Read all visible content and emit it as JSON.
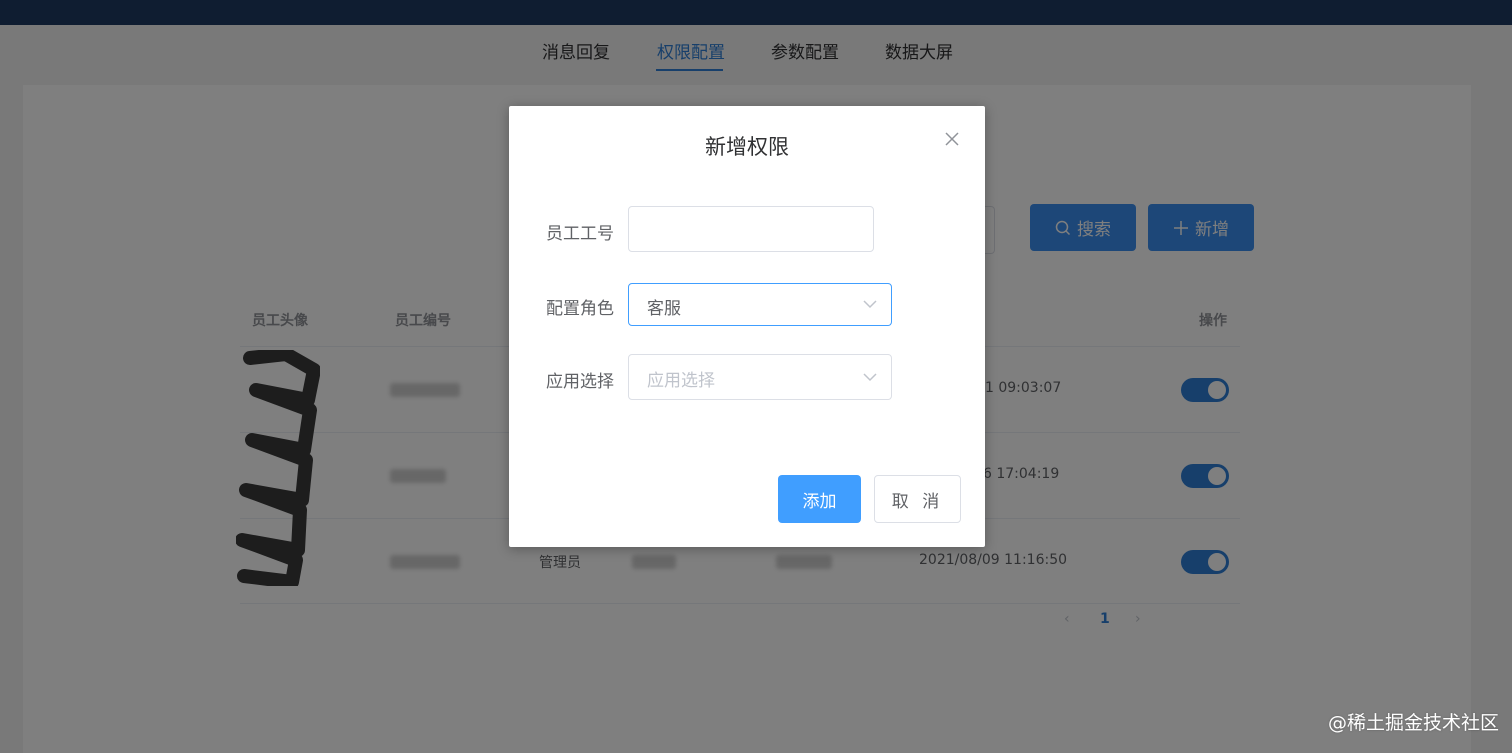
{
  "nav": {
    "tabs": [
      {
        "label": "消息回复"
      },
      {
        "label": "权限配置"
      },
      {
        "label": "参数配置"
      },
      {
        "label": "数据大屏"
      }
    ],
    "active_tab": "权限配置"
  },
  "toolbar": {
    "search_label": "搜索",
    "add_label": "新增",
    "search_icon": "search-icon",
    "add_icon": "plus-icon"
  },
  "table": {
    "headers": {
      "avatar": "员工头像",
      "employee_no": "员工编号",
      "actions": "操作"
    },
    "rows": [
      {
        "time": "1 09:03:07",
        "enabled": true
      },
      {
        "time": "6 17:04:19",
        "enabled": true
      },
      {
        "role": "管理员",
        "time": "2021/08/09 11:16:50",
        "enabled": true
      }
    ]
  },
  "pagination": {
    "current_page": "1",
    "prev": "‹",
    "next": "›"
  },
  "dialog": {
    "title": "新增权限",
    "close_icon": "close-icon",
    "fields": {
      "employee_id": {
        "label": "员工工号",
        "value": ""
      },
      "role": {
        "label": "配置角色",
        "value": "客服"
      },
      "app": {
        "label": "应用选择",
        "placeholder": "应用选择"
      }
    },
    "confirm_label": "添加",
    "cancel_label": "取 消"
  },
  "watermark": "@稀土掘金技术社区",
  "colors": {
    "primary": "#409eff",
    "nav_active": "#2f7fd6",
    "topbar": "#1f3b62"
  }
}
